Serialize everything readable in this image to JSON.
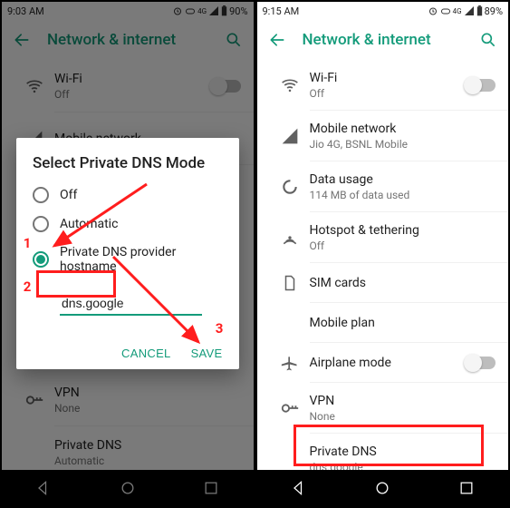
{
  "annot": {
    "one": "1",
    "two": "2",
    "three": "3"
  },
  "left": {
    "status": {
      "time": "9:03 AM",
      "battery": "90%"
    },
    "appbar": {
      "title": "Network & internet"
    },
    "rows": {
      "wifi": {
        "title": "Wi-Fi",
        "sub": "Off"
      },
      "mobile": {
        "title": "Mobile network"
      },
      "vpn": {
        "title": "VPN",
        "sub": "None"
      },
      "pdns": {
        "title": "Private DNS",
        "sub": "Automatic"
      }
    },
    "dialog": {
      "heading": "Select Private DNS Mode",
      "opt_off": "Off",
      "opt_auto": "Automatic",
      "opt_host": "Private DNS provider hostname",
      "hostname": "dns.google",
      "cancel": "CANCEL",
      "save": "SAVE"
    }
  },
  "right": {
    "status": {
      "time": "9:15 AM",
      "battery": "89%"
    },
    "appbar": {
      "title": "Network & internet"
    },
    "rows": {
      "wifi": {
        "title": "Wi-Fi",
        "sub": "Off"
      },
      "mobile": {
        "title": "Mobile network",
        "sub": "Jio 4G, BSNL Mobile"
      },
      "data": {
        "title": "Data usage",
        "sub": "114 MB of data used"
      },
      "hotspot": {
        "title": "Hotspot & tethering",
        "sub": "Off"
      },
      "sim": {
        "title": "SIM cards"
      },
      "mplan": {
        "title": "Mobile plan"
      },
      "airplane": {
        "title": "Airplane mode"
      },
      "vpn": {
        "title": "VPN",
        "sub": "None"
      },
      "pdns": {
        "title": "Private DNS",
        "sub": "dns.google"
      }
    }
  }
}
